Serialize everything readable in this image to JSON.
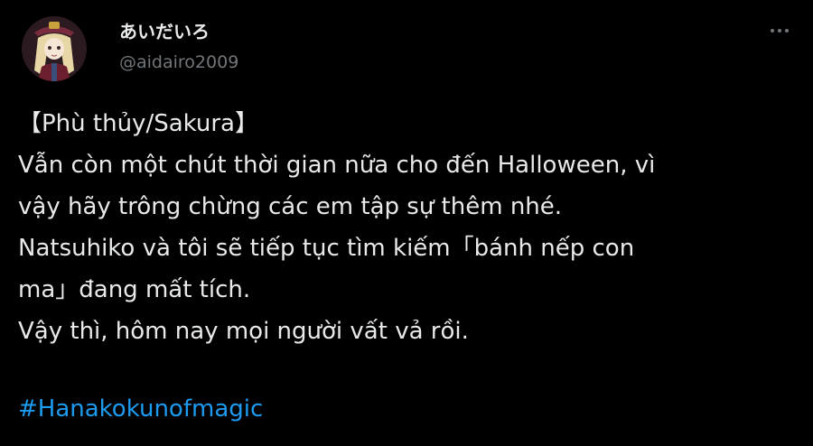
{
  "tweet": {
    "author": {
      "display_name": "あいだいろ",
      "handle": "@aidairo2009",
      "avatar_icon": "avatar-illustration"
    },
    "more_icon": "more-options-icon",
    "body_lines": [
      "【Phù thủy/Sakura】",
      "Vẫn còn một chút thời gian nữa cho đến Halloween, vì",
      "vậy hãy trông chừng các em tập sự thêm nhé.",
      "Natsuhiko và tôi sẽ tiếp tục tìm kiếm「bánh nếp con",
      "ma」đang mất tích.",
      "Vậy thì, hôm nay mọi người vất vả rồi."
    ],
    "hashtag": "#Hanakokunofmagic"
  },
  "colors": {
    "background": "#000000",
    "text": "#e7e9ea",
    "secondary_text": "#71767b",
    "link": "#1d9bf0"
  }
}
